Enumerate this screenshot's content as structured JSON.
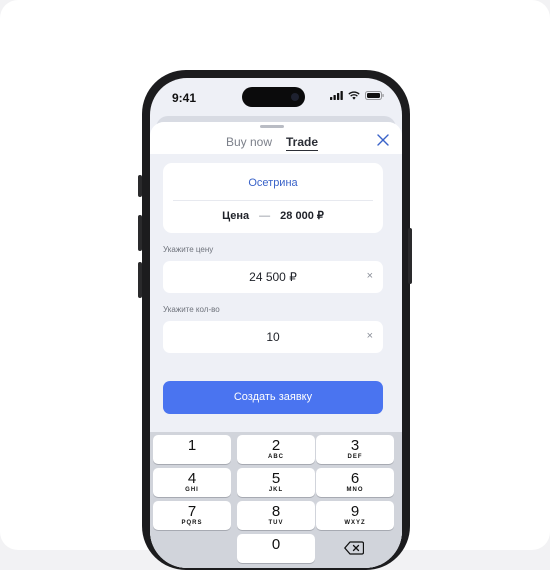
{
  "status_bar": {
    "time": "9:41"
  },
  "tabs": [
    {
      "label": "Buy now"
    },
    {
      "label": "Trade"
    }
  ],
  "product": {
    "name": "Осетрина",
    "price_label": "Цена",
    "price_separator": "—",
    "price_value": "28 000 ₽"
  },
  "price_field": {
    "label": "Укажите цену",
    "value": "24 500 ₽",
    "clear": "×"
  },
  "qty_field": {
    "label": "Укажите кол-во",
    "value": "10",
    "clear": "×"
  },
  "submit_label": "Создать заявку",
  "keypad": {
    "keys": [
      {
        "digit": "1",
        "letters": ""
      },
      {
        "digit": "2",
        "letters": "ABC"
      },
      {
        "digit": "3",
        "letters": "DEF"
      },
      {
        "digit": "4",
        "letters": "GHI"
      },
      {
        "digit": "5",
        "letters": "JKL"
      },
      {
        "digit": "6",
        "letters": "MNO"
      },
      {
        "digit": "7",
        "letters": "PQRS"
      },
      {
        "digit": "8",
        "letters": "TUV"
      },
      {
        "digit": "9",
        "letters": "WXYZ"
      },
      {
        "digit": "0",
        "letters": ""
      }
    ]
  },
  "colors": {
    "accent": "#4a74f0",
    "link": "#3a63c9",
    "background": "#eef0f6"
  }
}
